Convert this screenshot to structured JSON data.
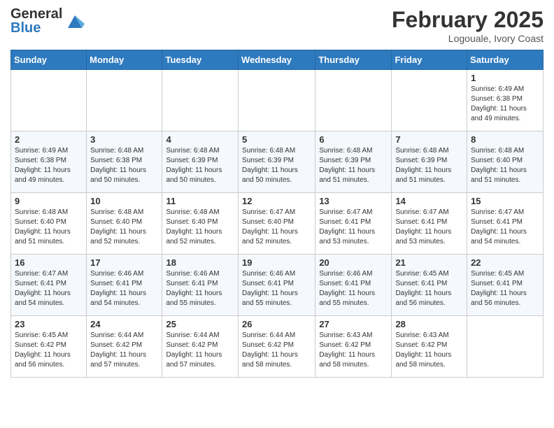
{
  "header": {
    "logo_general": "General",
    "logo_blue": "Blue",
    "month_title": "February 2025",
    "location": "Logouale, Ivory Coast"
  },
  "days_of_week": [
    "Sunday",
    "Monday",
    "Tuesday",
    "Wednesday",
    "Thursday",
    "Friday",
    "Saturday"
  ],
  "weeks": [
    [
      {
        "day": "",
        "info": ""
      },
      {
        "day": "",
        "info": ""
      },
      {
        "day": "",
        "info": ""
      },
      {
        "day": "",
        "info": ""
      },
      {
        "day": "",
        "info": ""
      },
      {
        "day": "",
        "info": ""
      },
      {
        "day": "1",
        "info": "Sunrise: 6:49 AM\nSunset: 6:38 PM\nDaylight: 11 hours\nand 49 minutes."
      }
    ],
    [
      {
        "day": "2",
        "info": "Sunrise: 6:49 AM\nSunset: 6:38 PM\nDaylight: 11 hours\nand 49 minutes."
      },
      {
        "day": "3",
        "info": "Sunrise: 6:48 AM\nSunset: 6:38 PM\nDaylight: 11 hours\nand 50 minutes."
      },
      {
        "day": "4",
        "info": "Sunrise: 6:48 AM\nSunset: 6:39 PM\nDaylight: 11 hours\nand 50 minutes."
      },
      {
        "day": "5",
        "info": "Sunrise: 6:48 AM\nSunset: 6:39 PM\nDaylight: 11 hours\nand 50 minutes."
      },
      {
        "day": "6",
        "info": "Sunrise: 6:48 AM\nSunset: 6:39 PM\nDaylight: 11 hours\nand 51 minutes."
      },
      {
        "day": "7",
        "info": "Sunrise: 6:48 AM\nSunset: 6:39 PM\nDaylight: 11 hours\nand 51 minutes."
      },
      {
        "day": "8",
        "info": "Sunrise: 6:48 AM\nSunset: 6:40 PM\nDaylight: 11 hours\nand 51 minutes."
      }
    ],
    [
      {
        "day": "9",
        "info": "Sunrise: 6:48 AM\nSunset: 6:40 PM\nDaylight: 11 hours\nand 51 minutes."
      },
      {
        "day": "10",
        "info": "Sunrise: 6:48 AM\nSunset: 6:40 PM\nDaylight: 11 hours\nand 52 minutes."
      },
      {
        "day": "11",
        "info": "Sunrise: 6:48 AM\nSunset: 6:40 PM\nDaylight: 11 hours\nand 52 minutes."
      },
      {
        "day": "12",
        "info": "Sunrise: 6:47 AM\nSunset: 6:40 PM\nDaylight: 11 hours\nand 52 minutes."
      },
      {
        "day": "13",
        "info": "Sunrise: 6:47 AM\nSunset: 6:41 PM\nDaylight: 11 hours\nand 53 minutes."
      },
      {
        "day": "14",
        "info": "Sunrise: 6:47 AM\nSunset: 6:41 PM\nDaylight: 11 hours\nand 53 minutes."
      },
      {
        "day": "15",
        "info": "Sunrise: 6:47 AM\nSunset: 6:41 PM\nDaylight: 11 hours\nand 54 minutes."
      }
    ],
    [
      {
        "day": "16",
        "info": "Sunrise: 6:47 AM\nSunset: 6:41 PM\nDaylight: 11 hours\nand 54 minutes."
      },
      {
        "day": "17",
        "info": "Sunrise: 6:46 AM\nSunset: 6:41 PM\nDaylight: 11 hours\nand 54 minutes."
      },
      {
        "day": "18",
        "info": "Sunrise: 6:46 AM\nSunset: 6:41 PM\nDaylight: 11 hours\nand 55 minutes."
      },
      {
        "day": "19",
        "info": "Sunrise: 6:46 AM\nSunset: 6:41 PM\nDaylight: 11 hours\nand 55 minutes."
      },
      {
        "day": "20",
        "info": "Sunrise: 6:46 AM\nSunset: 6:41 PM\nDaylight: 11 hours\nand 55 minutes."
      },
      {
        "day": "21",
        "info": "Sunrise: 6:45 AM\nSunset: 6:41 PM\nDaylight: 11 hours\nand 56 minutes."
      },
      {
        "day": "22",
        "info": "Sunrise: 6:45 AM\nSunset: 6:41 PM\nDaylight: 11 hours\nand 56 minutes."
      }
    ],
    [
      {
        "day": "23",
        "info": "Sunrise: 6:45 AM\nSunset: 6:42 PM\nDaylight: 11 hours\nand 56 minutes."
      },
      {
        "day": "24",
        "info": "Sunrise: 6:44 AM\nSunset: 6:42 PM\nDaylight: 11 hours\nand 57 minutes."
      },
      {
        "day": "25",
        "info": "Sunrise: 6:44 AM\nSunset: 6:42 PM\nDaylight: 11 hours\nand 57 minutes."
      },
      {
        "day": "26",
        "info": "Sunrise: 6:44 AM\nSunset: 6:42 PM\nDaylight: 11 hours\nand 58 minutes."
      },
      {
        "day": "27",
        "info": "Sunrise: 6:43 AM\nSunset: 6:42 PM\nDaylight: 11 hours\nand 58 minutes."
      },
      {
        "day": "28",
        "info": "Sunrise: 6:43 AM\nSunset: 6:42 PM\nDaylight: 11 hours\nand 58 minutes."
      },
      {
        "day": "",
        "info": ""
      }
    ]
  ]
}
